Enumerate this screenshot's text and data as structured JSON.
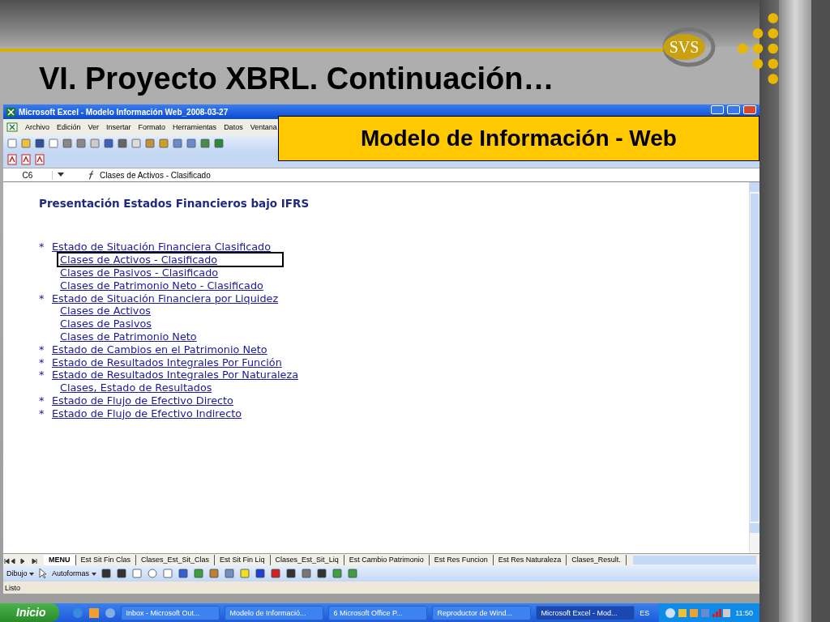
{
  "slide": {
    "title": "VI. Proyecto XBRL. Continuación…",
    "logo": "SVS",
    "banner": "Modelo de Información - Web"
  },
  "excel": {
    "title": "Microsoft Excel - Modelo Información Web_2008-03-27",
    "menu": [
      "Archivo",
      "Edición",
      "Ver",
      "Insertar",
      "Formato",
      "Herramientas",
      "Datos",
      "Ventana"
    ],
    "name_box": "C6",
    "formula": "Clases de Activos - Clasificado",
    "sheet_heading": "Presentación Estados Financieros bajo IFRS",
    "links": [
      {
        "bullet": "*",
        "text": "Estado de Situación Financiera Clasificado",
        "selected": false,
        "children": [
          {
            "text": "Clases de Activos - Clasificado",
            "selected": true
          },
          {
            "text": "Clases de Pasivos - Clasificado",
            "selected": false
          },
          {
            "text": "Clases de Patrimonio Neto - Clasificado",
            "selected": false
          }
        ]
      },
      {
        "bullet": "*",
        "text": "Estado de Situación Financiera por Liquidez",
        "selected": false,
        "children": [
          {
            "text": "Clases de Activos",
            "selected": false
          },
          {
            "text": "Clases de Pasivos",
            "selected": false
          },
          {
            "text": "Clases de Patrimonio Neto",
            "selected": false
          }
        ]
      },
      {
        "bullet": "*",
        "text": "Estado de Cambios en el Patrimonio Neto",
        "selected": false
      },
      {
        "bullet": "*",
        "text": "Estado de Resultados Integrales Por Función",
        "selected": false
      },
      {
        "bullet": "*",
        "text": "Estado de Resultados Integrales Por Naturaleza",
        "selected": false,
        "children": [
          {
            "text": "Clases, Estado de Resultados",
            "selected": false
          }
        ]
      },
      {
        "bullet": "*",
        "text": "Estado de Flujo de Efectivo Directo",
        "selected": false
      },
      {
        "bullet": "*",
        "text": "Estado de Flujo de Efectivo Indirecto",
        "selected": false
      }
    ],
    "sheet_tabs": [
      {
        "label": "MENU",
        "selected": true
      },
      {
        "label": "Est Sit Fin Clas",
        "selected": false
      },
      {
        "label": "Clases_Est_Sit_Clas",
        "selected": false
      },
      {
        "label": "Est Sit Fin Liq",
        "selected": false
      },
      {
        "label": "Clases_Est_Sit_Liq",
        "selected": false
      },
      {
        "label": "Est Cambio Patrimonio",
        "selected": false
      },
      {
        "label": "Est Res Funcion",
        "selected": false
      },
      {
        "label": "Est Res Naturaleza",
        "selected": false
      },
      {
        "label": "Clases_Result.",
        "selected": false
      }
    ],
    "drawing_menu": "Dibujo",
    "autoshapes": "Autoformas",
    "status": "Listo"
  },
  "taskbar": {
    "start": "Inicio",
    "tasks": [
      {
        "label": "Inbox - Microsoft Out...",
        "selected": false
      },
      {
        "label": "Modelo de Informació...",
        "selected": false
      },
      {
        "label": "6 Microsoft Office P...",
        "selected": false
      },
      {
        "label": "Reproductor de Wind...",
        "selected": false
      },
      {
        "label": "Microsoft Excel - Mod...",
        "selected": true
      }
    ],
    "language": "ES",
    "time": "11:50"
  }
}
